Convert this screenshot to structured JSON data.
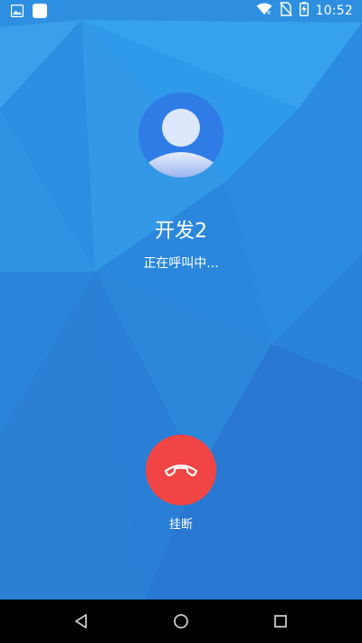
{
  "status_bar": {
    "time": "10:52",
    "left_icons": [
      "image-icon",
      "app-icon"
    ],
    "right_icons": [
      "wifi-icon",
      "no-sim-icon",
      "battery-charging-icon"
    ]
  },
  "call": {
    "caller_name": "开发2",
    "status_text": "正在呼叫中...",
    "hangup_label": "挂断"
  },
  "colors": {
    "background": "#2f8fe0",
    "hangup": "#f14444",
    "avatar": "#2f7ce6"
  },
  "nav_bar": {
    "buttons": [
      "back-icon",
      "home-icon",
      "recents-icon"
    ]
  }
}
